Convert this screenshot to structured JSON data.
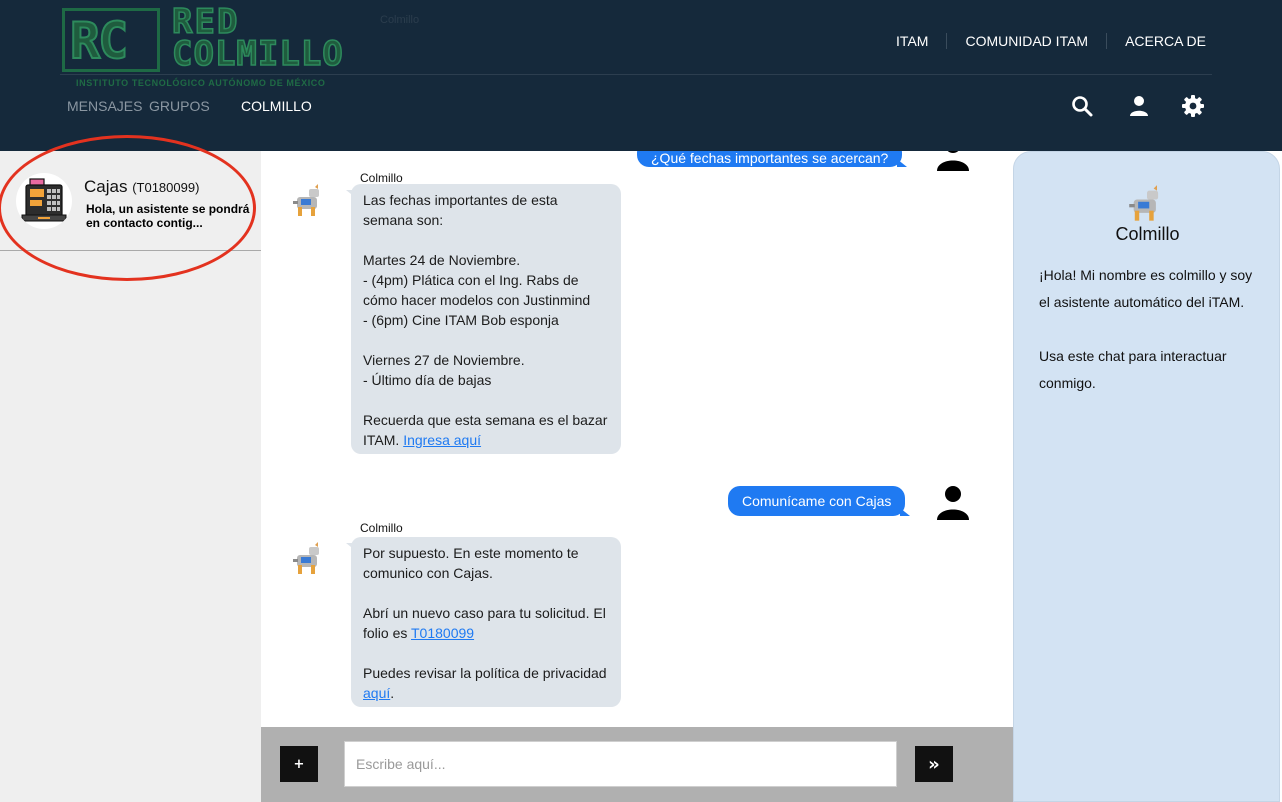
{
  "header": {
    "logo": {
      "initials": "RC",
      "line1": "RED",
      "line2": "COLMILLO",
      "subtitle": "INSTITUTO TECNOLÓGICO AUTÓNOMO DE MÉXICO",
      "ghost_label": "Colmillo"
    },
    "top_nav": [
      "ITAM",
      "COMUNIDAD ITAM",
      "ACERCA DE"
    ],
    "sub_nav": {
      "mensajes": "MENSAJES",
      "grupos": "GRUPOS",
      "colmillo": "COLMILLO"
    },
    "icons": [
      "search-icon",
      "user-icon",
      "gear-icon"
    ]
  },
  "conversations": [
    {
      "name": "Cajas",
      "folio": "(T0180099)",
      "preview": "Hola, un asistente se pondrá en contacto contig...",
      "icon": "cash-register-icon"
    }
  ],
  "chat": {
    "out_msg_1": "¿Qué fechas importantes se acercan?",
    "bot_msg_1": {
      "sender": "Colmillo",
      "p1": "Las fechas importantes de esta semana son:",
      "p2_line1": "Martes 24 de Noviembre.",
      "p2_line2": "- (4pm) Plática con el Ing. Rabs de cómo hacer modelos con Justinmind",
      "p2_line3": "- (6pm) Cine ITAM Bob esponja",
      "p3_line1": "Viernes 27 de Noviembre.",
      "p3_line2": "- Último día de bajas",
      "p4_text": "Recuerda que esta semana es el bazar ITAM.",
      "p4_link": "Ingresa aquí"
    },
    "out_msg_2": "Comunícame con Cajas",
    "bot_msg_2": {
      "sender": "Colmillo",
      "p1": "Por supuesto. En este momento te comunico con Cajas.",
      "p2_text": "Abrí un nuevo caso para tu solicitud. El folio es",
      "p2_link": "T0180099",
      "p3_text": "Puedes revisar la política de privacidad",
      "p3_link": "aquí",
      "p3_end": "."
    }
  },
  "composer": {
    "plus_label": "+",
    "placeholder": "Escribe aquí...",
    "send_label": "»"
  },
  "info_panel": {
    "title": "Colmillo",
    "text": "¡Hola! Mi nombre es colmillo y soy el asistente automático del iTAM.\n\nUsa este chat para interactuar conmigo."
  },
  "colors": {
    "header_bg": "#15293b",
    "accent_blue": "#1f7af2",
    "bot_bubble": "#dee4ea",
    "info_bg": "#d3e3f3",
    "annotation_red": "#e3321f"
  }
}
